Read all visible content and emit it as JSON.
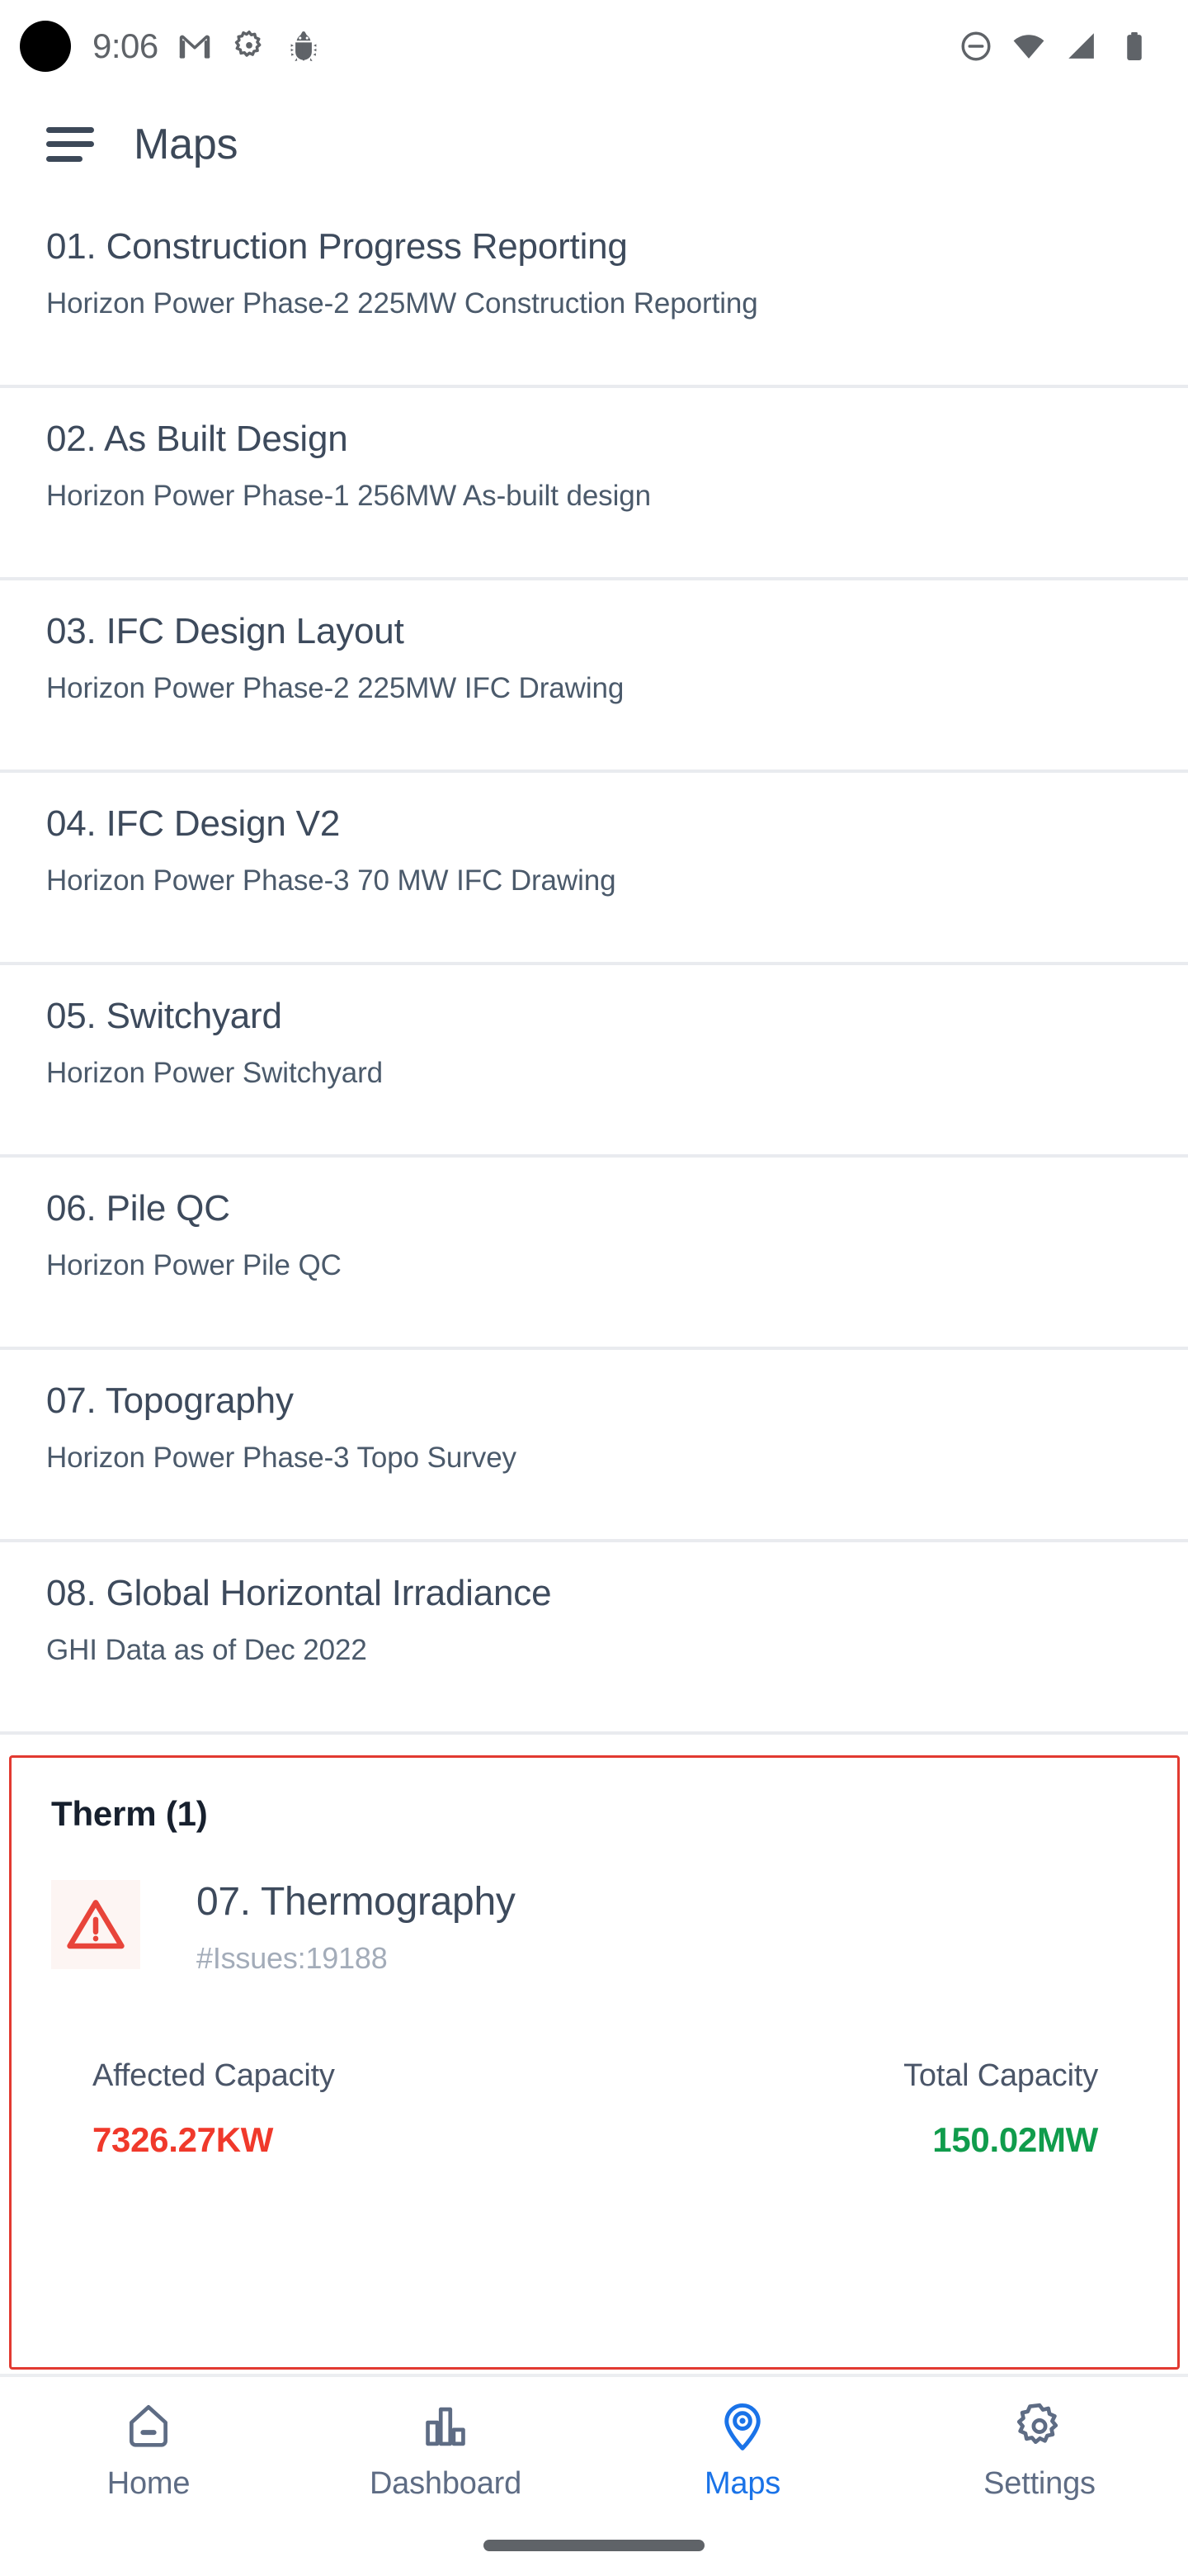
{
  "status_bar": {
    "time": "9:06",
    "left_icons": [
      "camera-cutout",
      "gmail-icon",
      "gear-icon",
      "android-bug-icon"
    ],
    "right_icons": [
      "do-not-disturb-icon",
      "wifi-icon",
      "cellular-signal-icon",
      "battery-icon"
    ]
  },
  "app_bar": {
    "menu_icon": "hamburger-menu-icon",
    "title": "Maps"
  },
  "map_list": {
    "items": [
      {
        "title": "01. Construction Progress Reporting",
        "subtitle": "Horizon Power Phase-2 225MW Construction Reporting"
      },
      {
        "title": "02. As Built Design",
        "subtitle": "Horizon Power Phase-1 256MW As-built design"
      },
      {
        "title": "03. IFC Design Layout",
        "subtitle": "Horizon Power Phase-2 225MW IFC Drawing"
      },
      {
        "title": "04. IFC Design V2",
        "subtitle": "Horizon Power Phase-3 70 MW IFC Drawing"
      },
      {
        "title": "05. Switchyard",
        "subtitle": "Horizon Power Switchyard"
      },
      {
        "title": "06. Pile QC",
        "subtitle": "Horizon Power Pile QC"
      },
      {
        "title": "07. Topography",
        "subtitle": "Horizon Power Phase-3 Topo Survey"
      },
      {
        "title": "08. Global Horizontal Irradiance",
        "subtitle": "GHI Data as of Dec 2022"
      }
    ]
  },
  "therm_card": {
    "heading": "Therm (1)",
    "alert_icon": "warning-triangle-icon",
    "title": "07. Thermography",
    "issues": "#Issues:19188",
    "affected_capacity_label": "Affected Capacity",
    "affected_capacity_value": "7326.27KW",
    "total_capacity_label": "Total Capacity",
    "total_capacity_value": "150.02MW",
    "border_color": "#e23a31",
    "affected_color": "#f0392b",
    "total_color": "#109c4c"
  },
  "bottom_nav": {
    "active_color": "#1a73e8",
    "inactive_color": "#5e6c84",
    "items": [
      {
        "label": "Home",
        "icon": "home-icon",
        "active": false
      },
      {
        "label": "Dashboard",
        "icon": "bar-chart-icon",
        "active": false
      },
      {
        "label": "Maps",
        "icon": "location-pin-icon",
        "active": true
      },
      {
        "label": "Settings",
        "icon": "gear-icon",
        "active": false
      }
    ]
  }
}
